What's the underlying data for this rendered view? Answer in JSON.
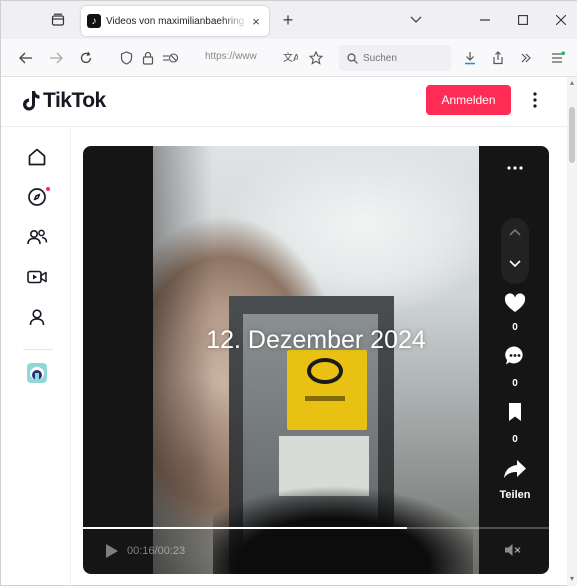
{
  "browser": {
    "tab_title": "Videos von maximilianbaehring",
    "url_display": "https://www.ti",
    "search_placeholder": "Suchen"
  },
  "tiktok": {
    "logo_text": "TikTok",
    "login_label": "Anmelden"
  },
  "video": {
    "overlay_text": "12. Dezember 2024",
    "like_count": "0",
    "comment_count": "0",
    "bookmark_count": "0",
    "share_label": "Teilen",
    "time_display": "00:16/00:23",
    "progress": 0.696
  },
  "colors": {
    "accent": "#fe2c55",
    "video_bg": "#151515"
  }
}
